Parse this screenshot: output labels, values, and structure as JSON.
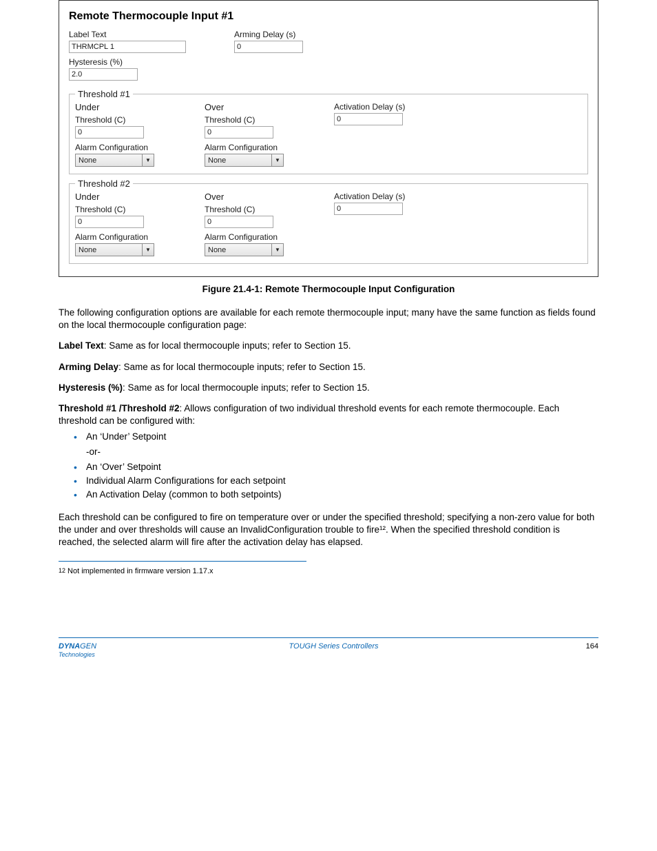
{
  "panel": {
    "title": "Remote Thermocouple Input #1",
    "label_text_label": "Label Text",
    "label_text_value": "THRMCPL 1",
    "arming_delay_label": "Arming Delay (s)",
    "arming_delay_value": "0",
    "hysteresis_label": "Hysteresis (%)",
    "hysteresis_value": "2.0",
    "threshold1": {
      "legend": "Threshold #1",
      "under_title": "Under",
      "under_threshold_label": "Threshold (C)",
      "under_threshold_value": "0",
      "under_alarm_label": "Alarm Configuration",
      "under_alarm_value": "None",
      "over_title": "Over",
      "over_threshold_label": "Threshold (C)",
      "over_threshold_value": "0",
      "over_alarm_label": "Alarm Configuration",
      "over_alarm_value": "None",
      "activation_label": "Activation Delay (s)",
      "activation_value": "0"
    },
    "threshold2": {
      "legend": "Threshold #2",
      "under_title": "Under",
      "under_threshold_label": "Threshold (C)",
      "under_threshold_value": "0",
      "under_alarm_label": "Alarm Configuration",
      "under_alarm_value": "None",
      "over_title": "Over",
      "over_threshold_label": "Threshold (C)",
      "over_threshold_value": "0",
      "over_alarm_label": "Alarm Configuration",
      "over_alarm_value": "None",
      "activation_label": "Activation Delay (s)",
      "activation_value": "0"
    }
  },
  "doc": {
    "figure_caption_bold": "Figure 21.4-1: Remote Thermocouple Input Configuration",
    "p1": "The following configuration options are available for each remote thermocouple input; many have the same function as fields found on the local thermocouple configuration page:",
    "field_label_text": "Label Text",
    "field_label_text_desc": ": Same as for local thermocouple inputs; refer to Section 15.",
    "field_arming_delay": "Arming Delay",
    "field_arming_delay_desc": ": Same as for local thermocouple inputs; refer to Section 15.",
    "field_hysteresis": "Hysteresis (%)",
    "field_hysteresis_desc": ": Same as for local thermocouple inputs; refer to Section 15.",
    "threshold_head": "Threshold #1 /Threshold #2",
    "threshold_desc": ": Allows configuration of two individual threshold events for each remote thermocouple. Each threshold can be configured with:",
    "bullets1": [
      "An ‘Under’ Setpoint"
    ],
    "or_line": "-or-",
    "bullets2": [
      "An ‘Over’ Setpoint",
      "Individual Alarm Configurations for each setpoint",
      "An Activation Delay (common to both setpoints)"
    ],
    "post_para": "Each threshold can be configured to fire on temperature over or under the specified threshold; specifying a non-zero value for both the under and over thresholds will cause an InvalidConfiguration trouble to fire¹². When the specified threshold condition is reached, the selected alarm will fire after the activation delay has elapsed.",
    "footnote_num": "12",
    "footnote_text": "Not implemented in firmware version 1.17.x",
    "footer_left": "DYNAGEN\nTechnologies",
    "footer_center": "TOUGH Series Controllers",
    "footer_right": "164"
  }
}
